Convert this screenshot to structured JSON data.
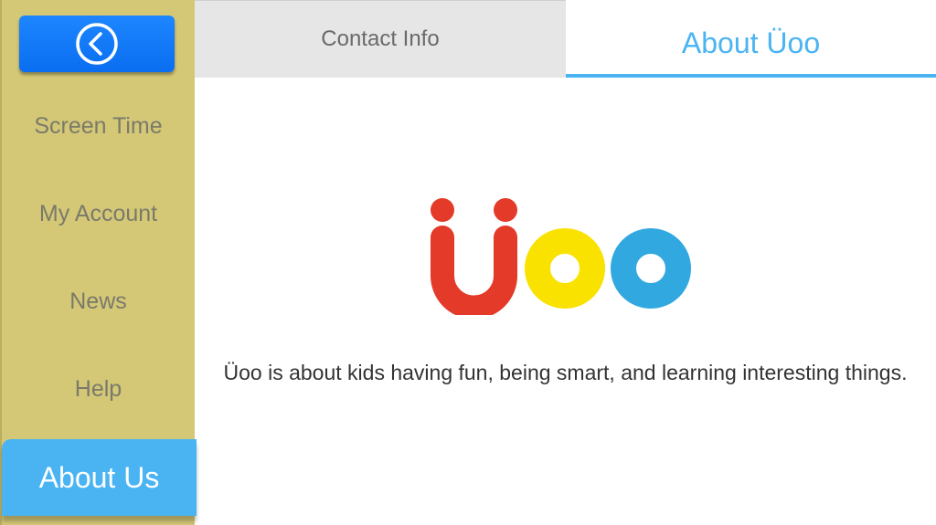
{
  "sidebar": {
    "back_button": {
      "icon": "chevron-left-circle-icon"
    },
    "items": [
      {
        "label": "Screen Time"
      },
      {
        "label": "My Account"
      },
      {
        "label": "News"
      },
      {
        "label": "Help"
      },
      {
        "label": "About Us",
        "active": true
      }
    ]
  },
  "tabs": [
    {
      "label": "Contact Info",
      "active": false
    },
    {
      "label": "About Üoo",
      "active": true
    }
  ],
  "main": {
    "logo": {
      "brand": "Üoo",
      "colors": {
        "u": "#e43a29",
        "o1": "#f9e200",
        "o2": "#32a8e0"
      }
    },
    "description": "Üoo is about kids having fun, being smart, and learning interesting things."
  },
  "colors": {
    "accent": "#4ab4f3",
    "sidebar_bg": "#d4c877",
    "back_button": "#1478ff"
  }
}
